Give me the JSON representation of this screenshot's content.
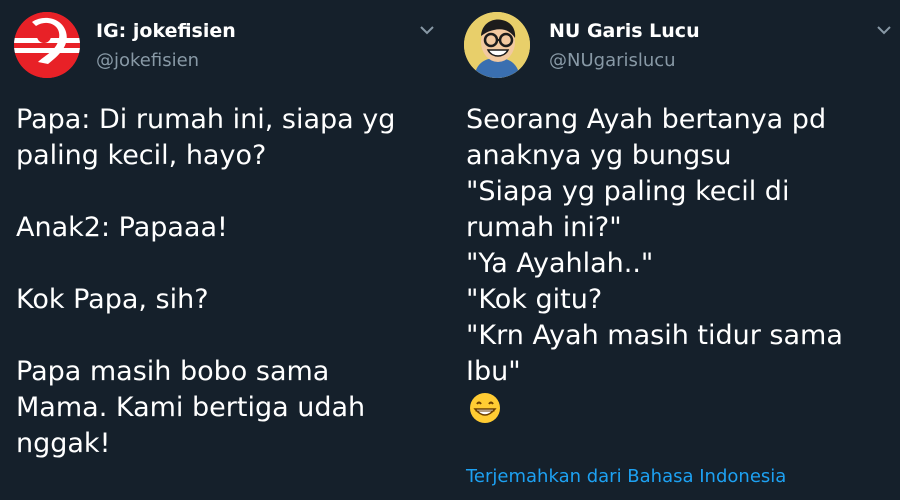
{
  "tweets": [
    {
      "display_name": "IG: jokefisien",
      "handle": "@jokefisien",
      "paragraphs": [
        [
          "Papa: Di rumah ini, siapa yg",
          "paling kecil, hayo?"
        ],
        [
          "Anak2: Papaaa!"
        ],
        [
          "Kok Papa, sih?"
        ],
        [
          "Papa masih bobo sama",
          "Mama. Kami bertiga udah",
          "nggak!"
        ]
      ],
      "avatar_icon": "logo-9-icon",
      "avatar_color": "#e82127"
    },
    {
      "display_name": "NU Garis Lucu",
      "handle": "@NUgarislucu",
      "lines": [
        "Seorang Ayah bertanya pd",
        "anaknya yg bungsu",
        "\"Siapa yg paling kecil di",
        "rumah ini?\"",
        "\"Ya Ayahlah..\"",
        "\"Kok gitu?",
        "\"Krn Ayah masih tidur sama",
        "Ibu\""
      ],
      "emoji": "grinning-face-icon",
      "translate_label": "Terjemahkan dari Bahasa Indonesia",
      "avatar_icon": "caricature-avatar-icon",
      "avatar_color": "#e8cf6a"
    }
  ],
  "colors": {
    "background": "#15202b",
    "text": "#ffffff",
    "secondary_text": "#8899a6",
    "link": "#1da1f2"
  }
}
